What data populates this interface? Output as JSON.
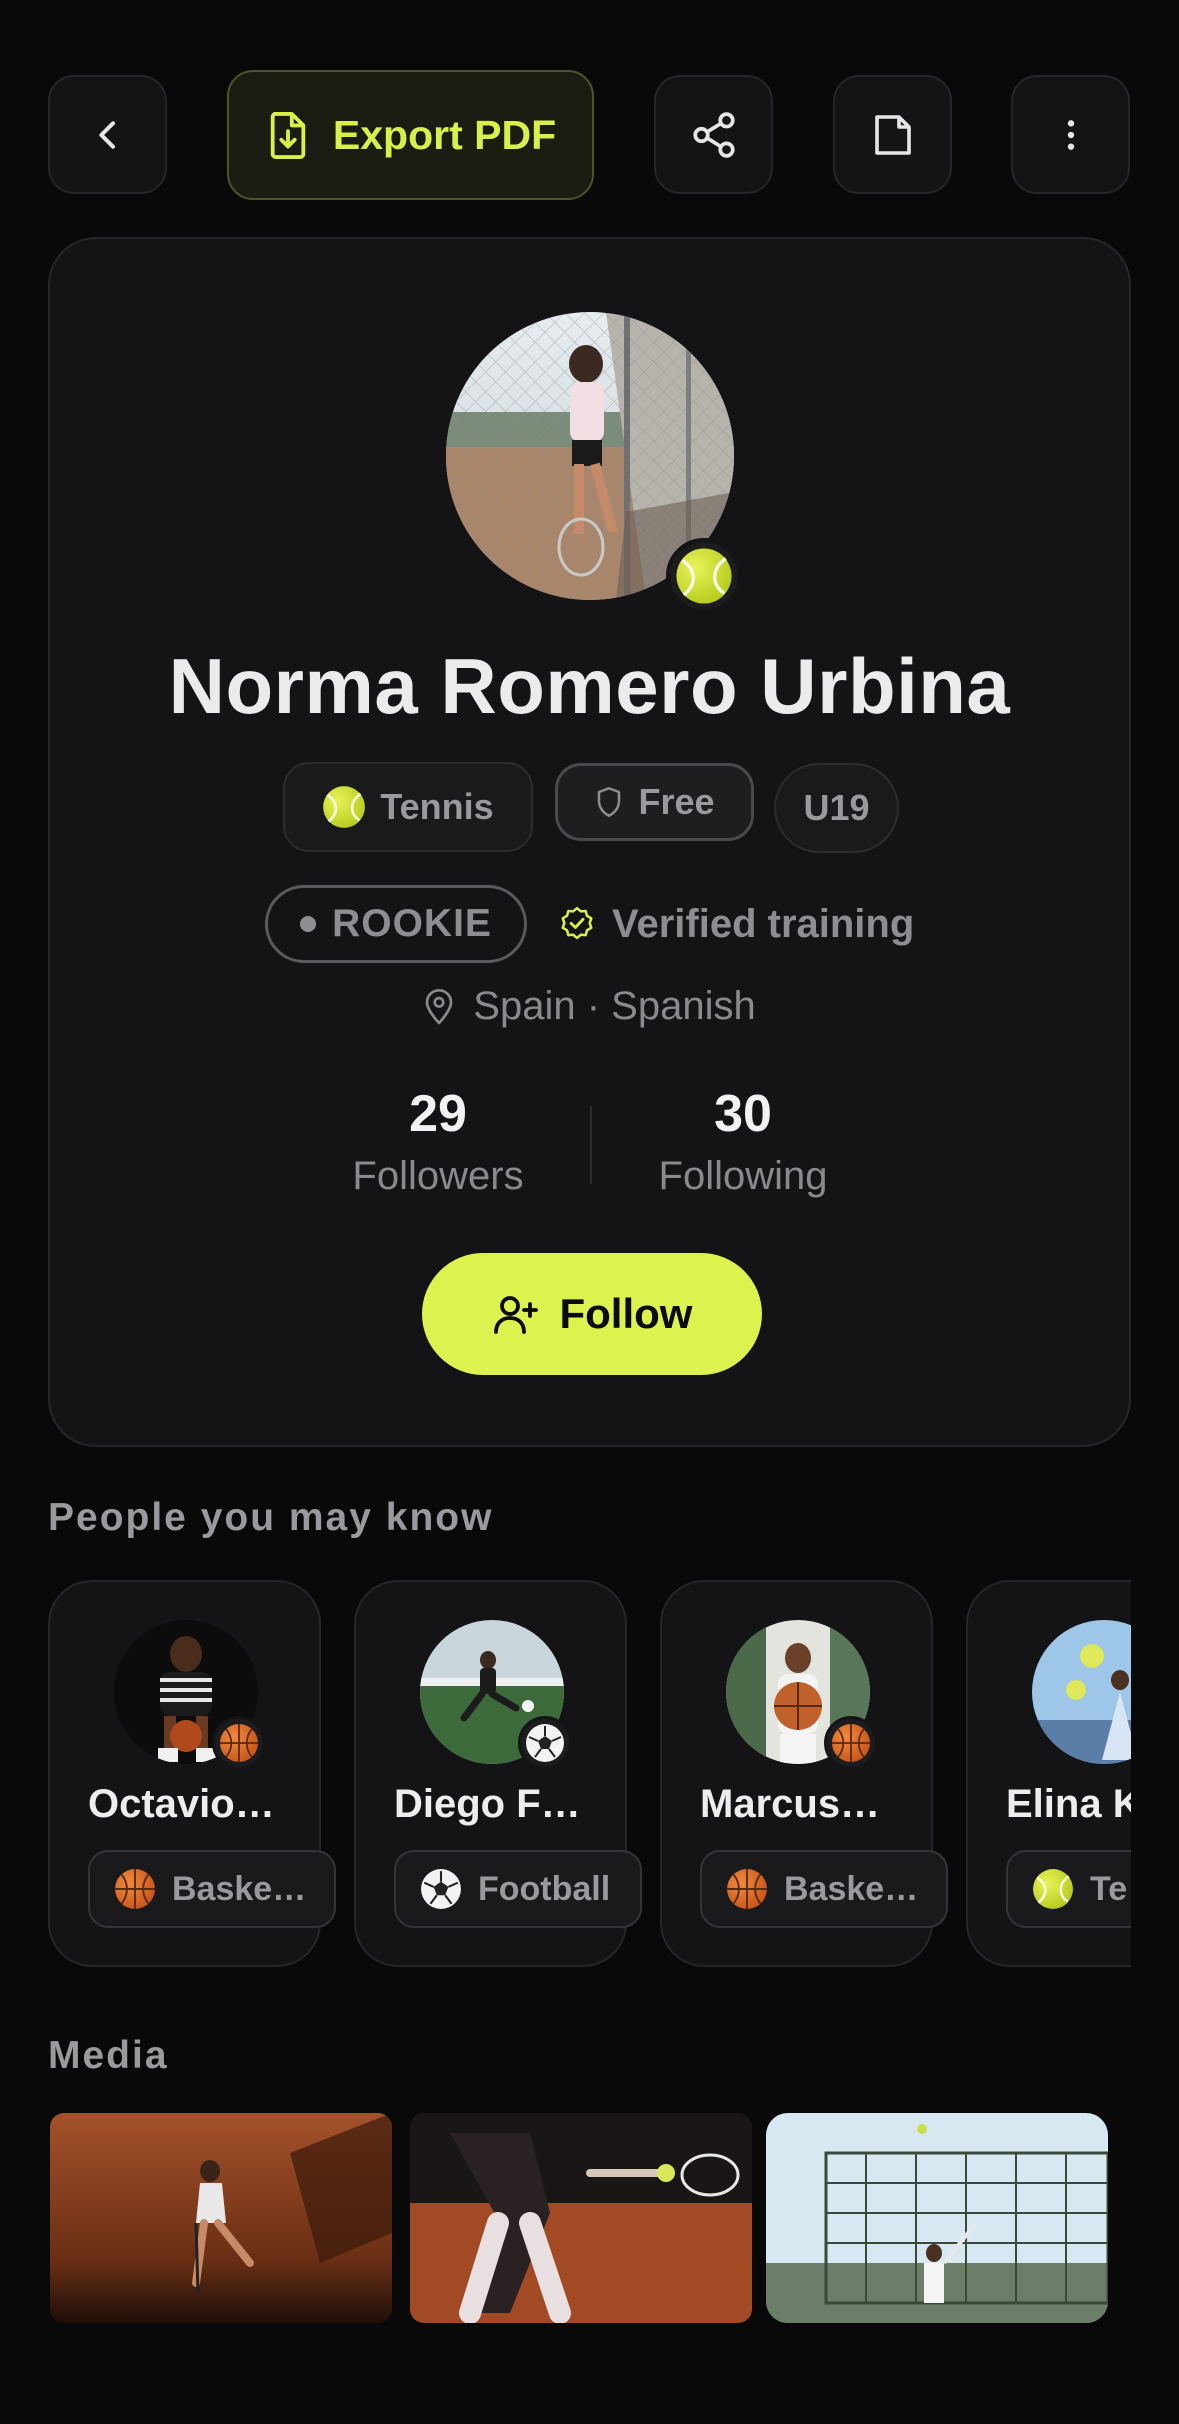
{
  "toolbar": {
    "export_label": "Export PDF"
  },
  "profile": {
    "name": "Norma Romero Urbina",
    "sport": "Tennis",
    "plan": "Free",
    "category": "U19",
    "level": "ROOKIE",
    "verified_label": "Verified training",
    "location": "Spain · Spanish",
    "followers_count": "29",
    "followers_label": "Followers",
    "following_count": "30",
    "following_label": "Following",
    "follow_label": "Follow"
  },
  "people_section": {
    "title": "People you may know",
    "people": [
      {
        "name": "Octavio…",
        "sport": "Baske…",
        "sport_icon": "basketball-icon"
      },
      {
        "name": "Diego F…",
        "sport": "Football",
        "sport_icon": "football-icon"
      },
      {
        "name": "Marcus…",
        "sport": "Baske…",
        "sport_icon": "basketball-icon"
      },
      {
        "name": "Elina K",
        "sport": "Te",
        "sport_icon": "tennis-ball-icon"
      }
    ]
  },
  "media_section": {
    "title": "Media"
  },
  "colors": {
    "accent": "#dcf24e",
    "background": "#090909",
    "card": "#141416"
  }
}
